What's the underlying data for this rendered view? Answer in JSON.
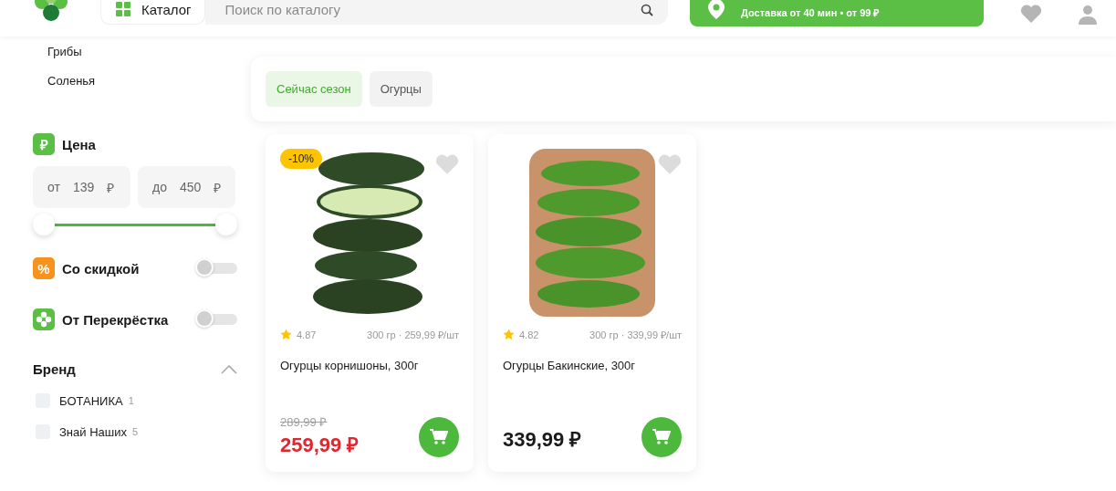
{
  "header": {
    "catalog_button": "Каталог",
    "search": {
      "placeholder": "Поиск по каталогу"
    },
    "delivery": {
      "subtitle": "Доставка от 40 мин • от 99 ₽"
    }
  },
  "sidebar": {
    "categories": [
      {
        "label": "Грибы"
      },
      {
        "label": "Соленья"
      }
    ],
    "price": {
      "title": "Цена",
      "icon": "₽",
      "from": {
        "prefix": "от",
        "value": "139",
        "currency": "₽"
      },
      "to": {
        "prefix": "до",
        "value": "450",
        "currency": "₽"
      },
      "thumbs": [
        {
          "level": 0
        },
        {
          "level": 1
        }
      ]
    },
    "toggles": [
      {
        "kind": "discount",
        "icon": "%",
        "label": "Со скидкой",
        "on": false
      },
      {
        "kind": "own",
        "label": "От Перекрёстка",
        "on": false
      }
    ],
    "brand": {
      "title": "Бренд",
      "expanded": true,
      "items": [
        {
          "label": "БОТАНИКА",
          "count": "1",
          "checked": false
        },
        {
          "label": "Знай Наших",
          "count": "5",
          "checked": false
        }
      ]
    }
  },
  "chips": [
    {
      "label": "Сейчас сезон",
      "selected": true
    },
    {
      "label": "Огурцы",
      "selected": false
    }
  ],
  "products": [
    {
      "kind": "loose",
      "badge": "-10%",
      "favorite": false,
      "rating": "4.87",
      "unit": "300 гр · 259,99 ₽/шт",
      "name": "Огурцы корнишоны, 300г",
      "old_price": "289,99 ₽",
      "price": "259,99 ₽"
    },
    {
      "kind": "tray",
      "favorite": false,
      "rating": "4.82",
      "unit": "300 гр · 339,99 ₽/шт",
      "name": "Огурцы Бакинские, 300г",
      "price": "339,99 ₽"
    }
  ]
}
